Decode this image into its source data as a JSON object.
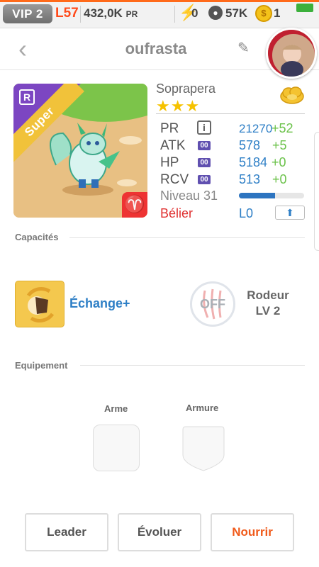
{
  "status_bar": {
    "vip": "VIP 2",
    "level": "L57",
    "power": "432,0K",
    "power_unit": "PR",
    "energy": "0",
    "paws": "57K",
    "coins": "1",
    "accent_color": "#ff6a1a"
  },
  "header": {
    "title": "oufrasta",
    "back_icon": "chevron-left-icon",
    "edit_icon": "pencil-icon"
  },
  "pet": {
    "name": "Soprapera",
    "stars": "★★★",
    "star_count": 3,
    "rarity_letter": "R",
    "rarity_label": "Super",
    "stats": [
      {
        "label": "PR",
        "value": "21270",
        "bonus": "+52"
      },
      {
        "label": "ATK",
        "badge": "00",
        "value": "578",
        "bonus": "+5"
      },
      {
        "label": "HP",
        "badge": "00",
        "value": "5184",
        "bonus": "+0"
      },
      {
        "label": "RCV",
        "badge": "00",
        "value": "513",
        "bonus": "+0"
      }
    ],
    "level_text": "Niveau 31",
    "xp_fraction": 0.55,
    "zodiac": "Bélier",
    "zodiac_symbol": "♈",
    "rank": "L0"
  },
  "abilities": {
    "title": "Capacités",
    "active_name": "Échange+",
    "passive_state": "OFF",
    "passive_name_line1": "Rodeur",
    "passive_name_line2": "LV 2"
  },
  "equipment": {
    "title": "Equipement",
    "weapon_label": "Arme",
    "armor_label": "Armure"
  },
  "actions": {
    "leader": "Leader",
    "evolve": "Évoluer",
    "feed": "Nourrir"
  }
}
